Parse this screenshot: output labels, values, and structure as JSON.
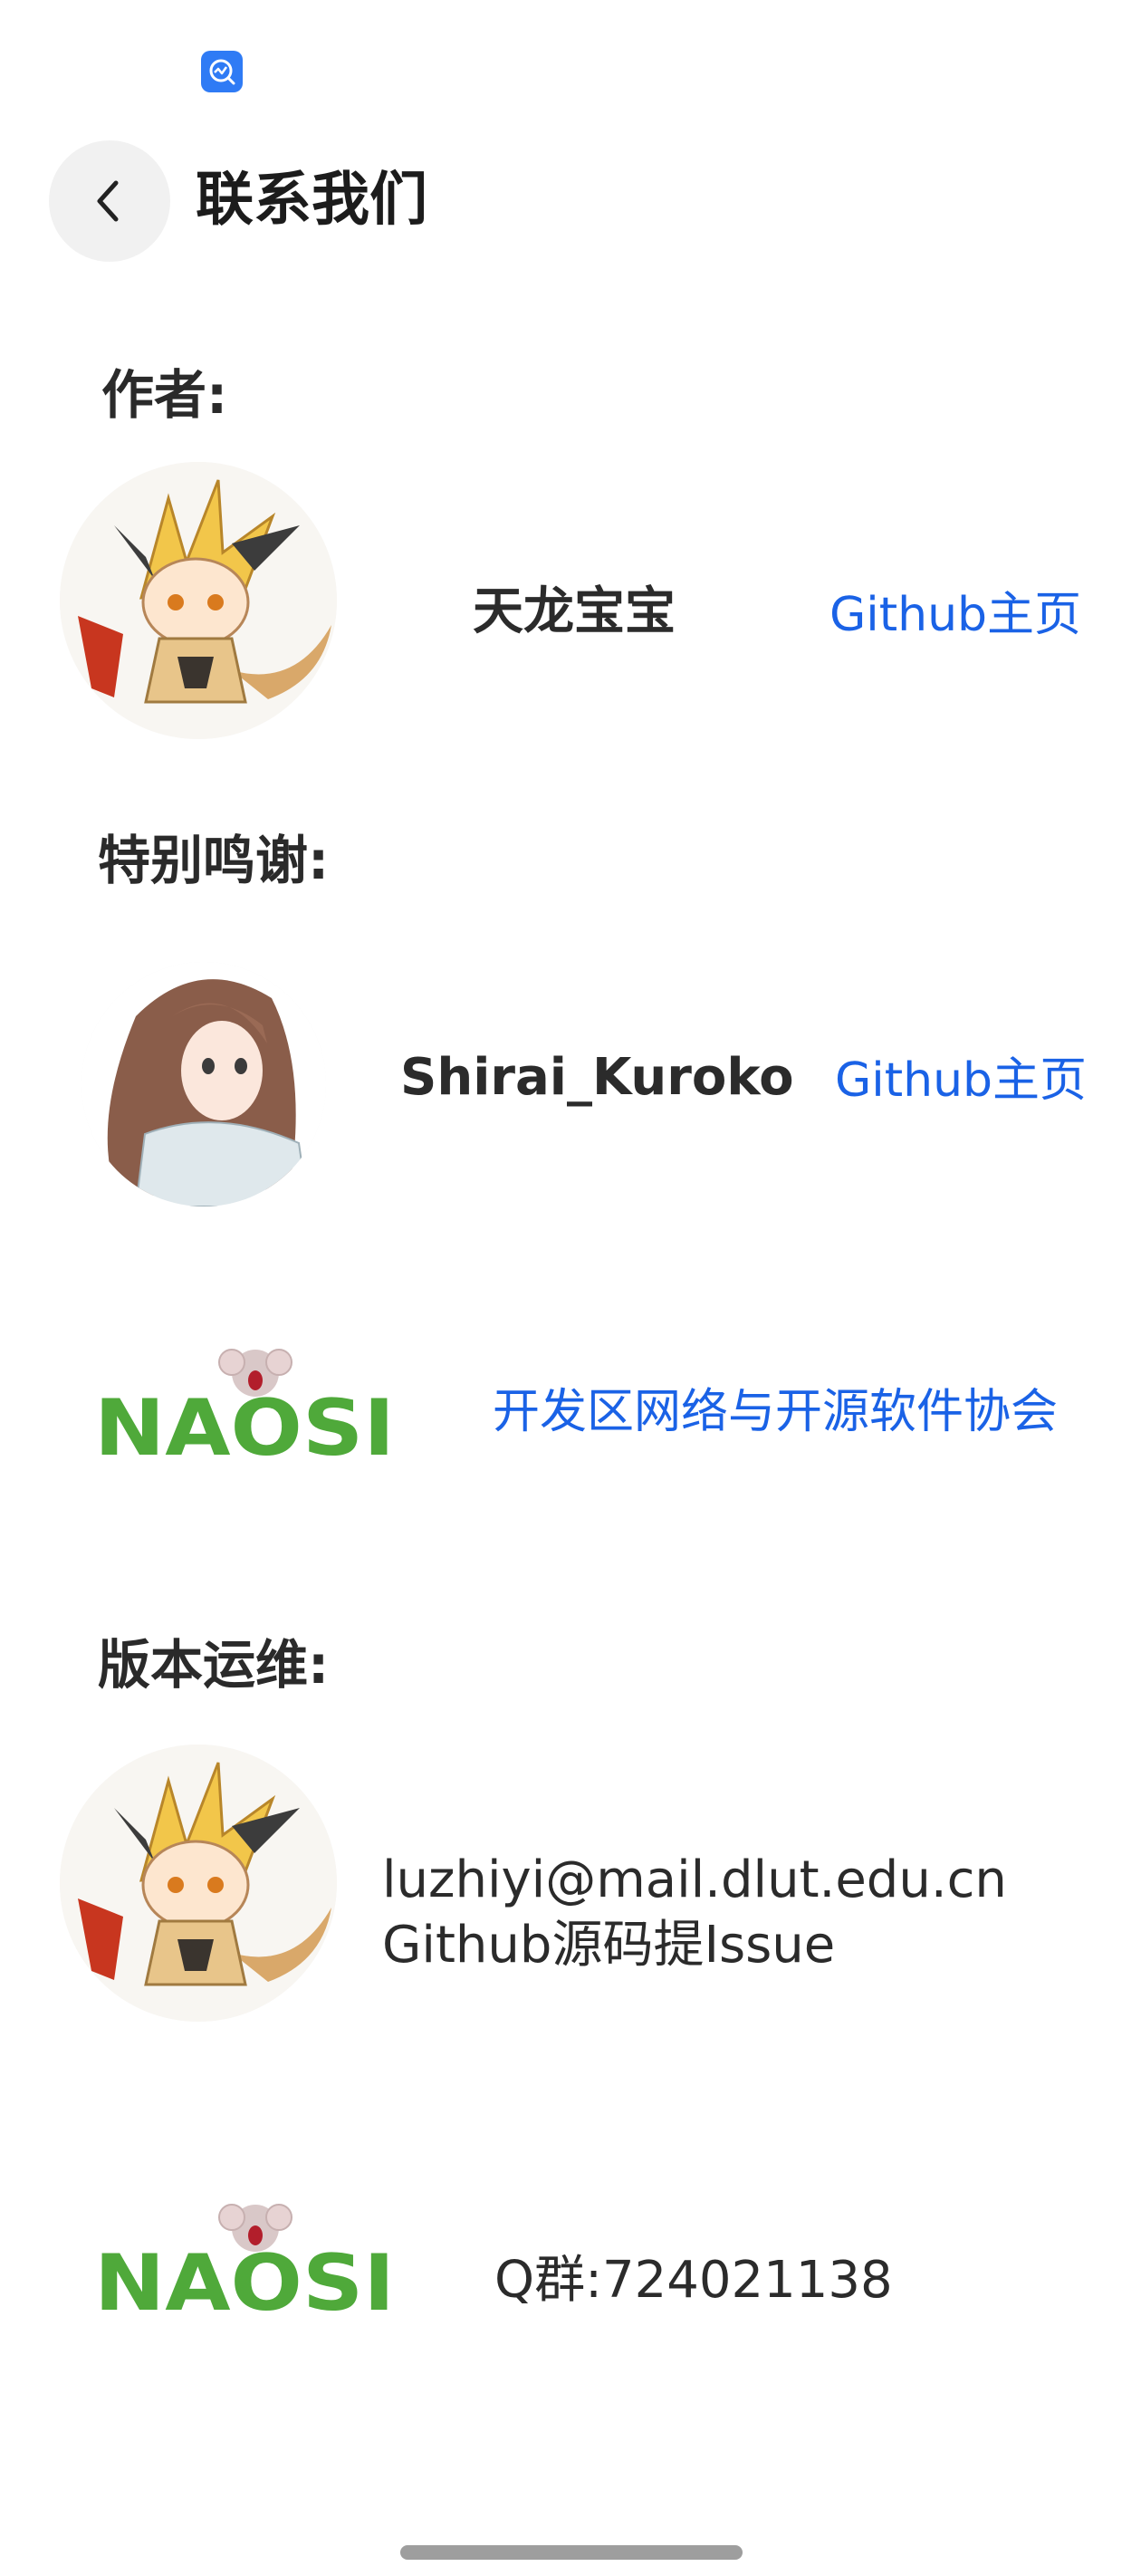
{
  "header": {
    "title": "联系我们",
    "back_icon": "chevron-left-icon"
  },
  "status_bar": {
    "app_icon": "activity-monitor-icon",
    "app_icon_color": "#2f7bf5"
  },
  "author_section": {
    "heading": "作者:",
    "name": "天龙宝宝",
    "link_label": "Github主页"
  },
  "thanks_section": {
    "heading": "特别鸣谢:",
    "person_name": "Shirai_Kuroko",
    "person_link_label": "Github主页",
    "org_logo_text": "NAOSI",
    "org_link_label": "开发区网络与开源软件协会"
  },
  "maintenance_section": {
    "heading": "版本运维:",
    "email": "luzhiyi@mail.dlut.edu.cn",
    "issue_text": "Github源码提Issue",
    "org_logo_text": "NAOSI",
    "qq_group": "Q群:724021138"
  },
  "colors": {
    "link": "#1a62e6",
    "logo_green": "#4fa93a",
    "back_button_bg": "#f1f1f1"
  }
}
